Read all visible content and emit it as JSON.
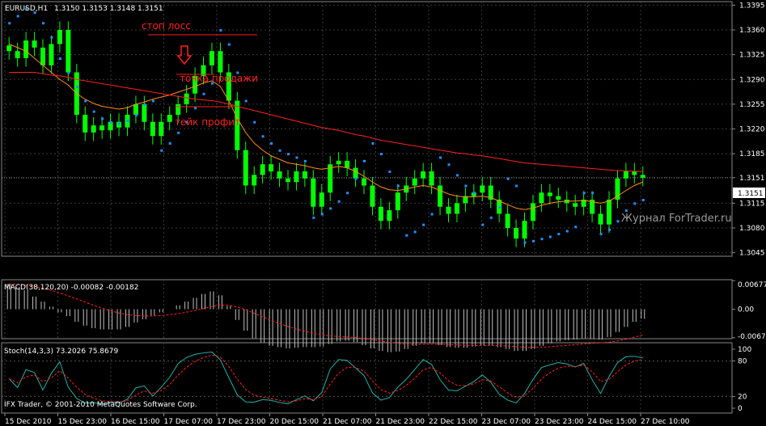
{
  "header": {
    "symbol": "EURUSD,H1",
    "ohlc": "1.3150 1.3153 1.3148 1.3151"
  },
  "annotations": {
    "stop_loss": "стоп лосс",
    "sell_point": "точка продажи",
    "take_profit": "тейк профит"
  },
  "watermark": "Журнал ForTrader.ru",
  "copyright": "IFX Trader, © 2001-2010 MetaQuotes Software Corp.",
  "macd_header": "MACD(38,120,20) -0.00082 -0.00182",
  "stoch_header": "Stoch(14,3,3) 73.2026 75.8679",
  "current_price_label": "1.3151",
  "colors": {
    "background": "#000000",
    "candle": "#00ff00",
    "ma_fast": "#ff8c1a",
    "ma_slow": "#ff2020",
    "parabolic_sar": "#1e90ff",
    "macd_histogram": "#c0c0c0",
    "macd_signal": "#ff2020",
    "stoch_main": "#20b2aa",
    "stoch_signal": "#ff2020",
    "annotation": "#ff2020",
    "grid": "#3a3a3a"
  },
  "chart_data": [
    {
      "type": "line",
      "name": "price",
      "y_ticks": [
        "1.3395",
        "1.3360",
        "1.3325",
        "1.3290",
        "1.3255",
        "1.3220",
        "1.3185",
        "1.3151",
        "1.3115",
        "1.3080",
        "1.3045"
      ],
      "ylim": [
        1.304,
        1.34
      ],
      "x_ticks": [
        "15 Dec 2010",
        "15 Dec 23:00",
        "16 Dec 15:00",
        "17 Dec 07:00",
        "17 Dec 23:00",
        "20 Dec 15:00",
        "21 Dec 07:00",
        "21 Dec 23:00",
        "22 Dec 15:00",
        "23 Dec 07:00",
        "23 Dec 23:00",
        "24 Dec 15:00",
        "27 Dec 10:00"
      ],
      "close": [
        1.333,
        1.332,
        1.3345,
        1.3335,
        1.331,
        1.334,
        1.336,
        1.33,
        1.324,
        1.3215,
        1.3225,
        1.3218,
        1.323,
        1.3222,
        1.324,
        1.3255,
        1.323,
        1.321,
        1.323,
        1.324,
        1.3255,
        1.327,
        1.3295,
        1.331,
        1.333,
        1.33,
        1.326,
        1.319,
        1.314,
        1.3155,
        1.317,
        1.316,
        1.315,
        1.3145,
        1.316,
        1.315,
        1.311,
        1.313,
        1.317,
        1.3175,
        1.3165,
        1.315,
        1.314,
        1.311,
        1.309,
        1.3105,
        1.313,
        1.314,
        1.315,
        1.316,
        1.314,
        1.311,
        1.31,
        1.3115,
        1.3125,
        1.313,
        1.314,
        1.312,
        1.31,
        1.308,
        1.3065,
        1.309,
        1.3115,
        1.313,
        1.3125,
        1.312,
        1.3115,
        1.311,
        1.312,
        1.31,
        1.3085,
        1.312,
        1.315,
        1.316,
        1.3155,
        1.3151
      ],
      "ma_fast": [
        1.334,
        1.3335,
        1.333,
        1.332,
        1.331,
        1.33,
        1.329,
        1.3282,
        1.327,
        1.3262,
        1.3256,
        1.3252,
        1.325,
        1.3248,
        1.325,
        1.3255,
        1.3258,
        1.3262,
        1.3265,
        1.3268,
        1.3272,
        1.3276,
        1.328,
        1.3285,
        1.3288,
        1.328,
        1.326,
        1.3235,
        1.3215,
        1.32,
        1.319,
        1.3182,
        1.3177,
        1.3172,
        1.317,
        1.3168,
        1.3165,
        1.3163,
        1.3165,
        1.3167,
        1.3165,
        1.316,
        1.3153,
        1.3145,
        1.3138,
        1.3134,
        1.3133,
        1.3135,
        1.3138,
        1.314,
        1.3138,
        1.3133,
        1.3128,
        1.3125,
        1.3124,
        1.3124,
        1.3125,
        1.3123,
        1.3118,
        1.3113,
        1.3108,
        1.3106,
        1.3108,
        1.3112,
        1.3115,
        1.3117,
        1.3118,
        1.3118,
        1.3119,
        1.3117,
        1.3115,
        1.3118,
        1.3125,
        1.3133,
        1.314,
        1.3145
      ],
      "ma_slow": [
        1.33,
        1.33,
        1.33,
        1.33,
        1.3298,
        1.3296,
        1.3295,
        1.3293,
        1.329,
        1.3288,
        1.3286,
        1.3284,
        1.3282,
        1.328,
        1.3278,
        1.3276,
        1.3274,
        1.3272,
        1.327,
        1.3268,
        1.3266,
        1.3264,
        1.3262,
        1.3261,
        1.326,
        1.3258,
        1.3255,
        1.3252,
        1.3249,
        1.3246,
        1.3243,
        1.324,
        1.3237,
        1.3234,
        1.3231,
        1.3228,
        1.3225,
        1.3222,
        1.322,
        1.3218,
        1.3215,
        1.3212,
        1.321,
        1.3207,
        1.3204,
        1.3202,
        1.32,
        1.3198,
        1.3196,
        1.3194,
        1.3192,
        1.319,
        1.3188,
        1.3186,
        1.3185,
        1.3183,
        1.3182,
        1.318,
        1.3178,
        1.3176,
        1.3174,
        1.3172,
        1.3171,
        1.317,
        1.3169,
        1.3168,
        1.3167,
        1.3166,
        1.3165,
        1.3164,
        1.3163,
        1.3162,
        1.3161,
        1.3161,
        1.316,
        1.316
      ],
      "sar": [
        1.337,
        1.338,
        1.339,
        1.3385,
        1.337,
        1.335,
        1.332,
        1.33,
        1.328,
        1.326,
        1.3245,
        1.3235,
        1.323,
        1.3228,
        1.3232,
        1.324,
        1.3255,
        1.326,
        1.319,
        1.32,
        1.3215,
        1.323,
        1.325,
        1.327,
        1.3285,
        1.336,
        1.334,
        1.33,
        1.326,
        1.323,
        1.321,
        1.32,
        1.319,
        1.3185,
        1.318,
        1.3175,
        1.3095,
        1.31,
        1.3108,
        1.3118,
        1.313,
        1.315,
        1.3175,
        1.32,
        1.3185,
        1.316,
        1.314,
        1.307,
        1.3075,
        1.3085,
        1.31,
        1.318,
        1.317,
        1.3155,
        1.314,
        1.313,
        1.3085,
        1.3095,
        1.311,
        1.315,
        1.314,
        1.306,
        1.3062,
        1.3065,
        1.3068,
        1.3072,
        1.3076,
        1.3082,
        1.313,
        1.313,
        1.3072,
        1.3078,
        1.309,
        1.3105,
        1.3115,
        1.312
      ]
    },
    {
      "type": "bar",
      "name": "MACD(38,120,20)",
      "y_ticks": [
        "0.00677",
        "0.00",
        "-0.00677"
      ],
      "ylim": [
        -0.007,
        0.007
      ]
    },
    {
      "type": "line",
      "name": "Stoch(14,3,3)",
      "y_ticks": [
        "100",
        "80",
        "20",
        "0"
      ],
      "ylim": [
        0,
        100
      ]
    }
  ]
}
